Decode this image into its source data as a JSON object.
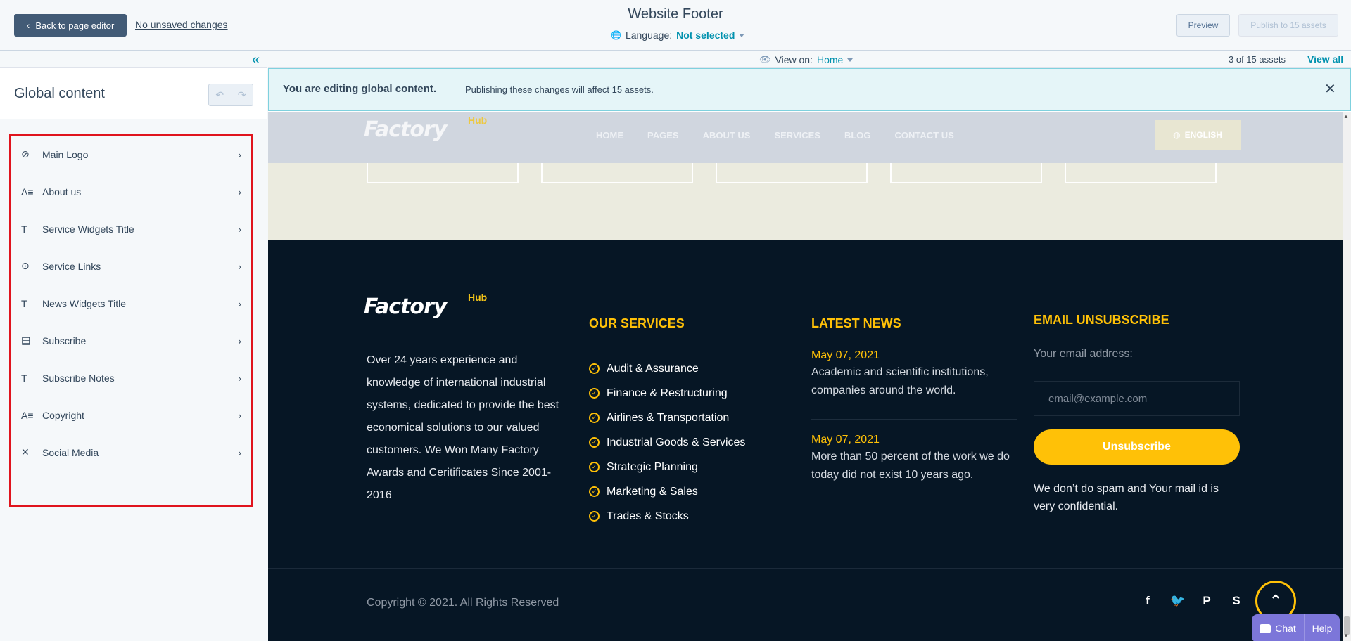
{
  "header": {
    "back_label": "Back to page editor",
    "unsaved": "No unsaved changes",
    "title": "Website Footer",
    "language_label": "Language:",
    "language_value": "Not selected",
    "preview": "Preview",
    "publish": "Publish to 15 assets"
  },
  "sidebar": {
    "title": "Global content",
    "items": [
      {
        "label": "Main Logo",
        "icon": "logo-icon"
      },
      {
        "label": "About us",
        "icon": "rich-text-icon"
      },
      {
        "label": "Service Widgets Title",
        "icon": "text-icon"
      },
      {
        "label": "Service Links",
        "icon": "links-icon"
      },
      {
        "label": "News Widgets Title",
        "icon": "text-icon"
      },
      {
        "label": "Subscribe",
        "icon": "form-icon"
      },
      {
        "label": "Subscribe Notes",
        "icon": "text-icon"
      },
      {
        "label": "Copyright",
        "icon": "rich-text-icon"
      },
      {
        "label": "Social Media",
        "icon": "social-icon"
      }
    ]
  },
  "toolbar": {
    "view_on_label": "View on:",
    "view_on_value": "Home",
    "assets_count": "3 of 15 assets",
    "view_all": "View all"
  },
  "alert": {
    "strong": "You are editing global content.",
    "message": "Publishing these changes will affect 15 assets."
  },
  "site": {
    "logo_text": "Factory",
    "logo_hub": "Hub",
    "nav": [
      "HOME",
      "PAGES",
      "ABOUT US",
      "SERVICES",
      "BLOG",
      "CONTACT US"
    ],
    "lang_button": "ENGLISH",
    "footer": {
      "about": "Over 24 years experience and knowledge of international industrial systems, dedicated to provide the best economical solutions to our valued customers. We Won Many Factory Awards and Ceritificates Since 2001-2016",
      "services_title": "OUR SERVICES",
      "services": [
        "Audit & Assurance",
        "Finance & Restructuring",
        "Airlines & Transportation",
        "Industrial Goods & Services",
        "Strategic Planning",
        "Marketing & Sales",
        "Trades & Stocks"
      ],
      "news_title": "LATEST NEWS",
      "news": [
        {
          "date": "May 07, 2021",
          "text": "Academic and scientific institutions, companies around the world."
        },
        {
          "date": "May 07, 2021",
          "text": "More than 50 percent of the work we do today did not exist 10 years ago."
        }
      ],
      "email_title": "EMAIL UNSUBSCRIBE",
      "email_label": "Your email address:",
      "email_placeholder": "email@example.com",
      "unsubscribe_button": "Unsubscribe",
      "note": "We don’t do spam and Your mail id is very confidential.",
      "copyright": "Copyright © 2021. All Rights Reserved",
      "socials": [
        "facebook-icon",
        "twitter-icon",
        "pinterest-icon",
        "skype-icon"
      ]
    },
    "chat": {
      "chat": "Chat",
      "help": "Help"
    }
  }
}
